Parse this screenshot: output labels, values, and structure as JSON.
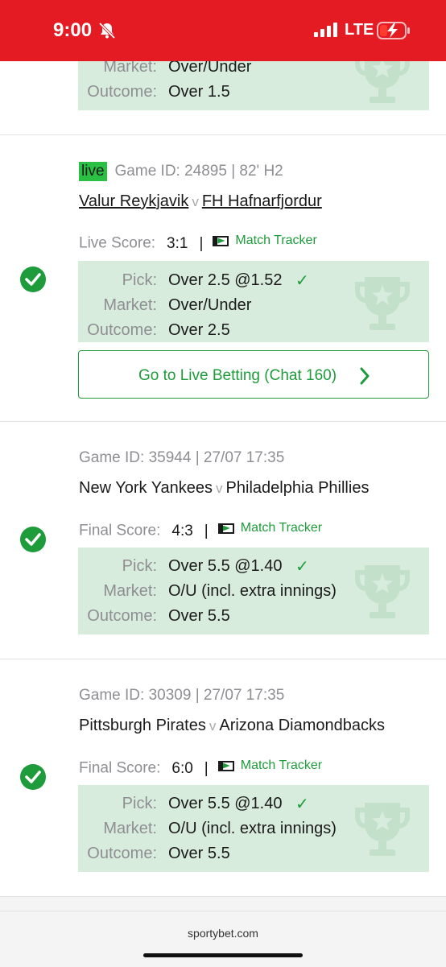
{
  "status_bar": {
    "time": "9:00",
    "network": "LTE"
  },
  "top_partial": {
    "market_label": "Market:",
    "market_value": "Over/Under",
    "outcome_label": "Outcome:",
    "outcome_value": "Over 1.5"
  },
  "bets": [
    {
      "live_label": "live",
      "game_id": "Game ID: 24895 | 82' H2",
      "home": "Valur Reykjavik",
      "vs": "v",
      "away": "FH Hafnarfjordur",
      "score_label": "Live Score:",
      "score": "3:1",
      "separator": "|",
      "tracker": "Match Tracker",
      "pick_label": "Pick:",
      "pick": "Over 2.5 @1.52",
      "market_label": "Market:",
      "market": "Over/Under",
      "outcome_label": "Outcome:",
      "outcome": "Over 2.5",
      "live_button": "Go to Live Betting (Chat 160)"
    },
    {
      "game_id": "Game ID: 35944 | 27/07 17:35",
      "home": "New York Yankees",
      "vs": "v",
      "away": "Philadelphia Phillies",
      "score_label": "Final Score:",
      "score": "4:3",
      "separator": "|",
      "tracker": "Match Tracker",
      "pick_label": "Pick:",
      "pick": "Over 5.5 @1.40",
      "market_label": "Market:",
      "market": "O/U (incl. extra innings)",
      "outcome_label": "Outcome:",
      "outcome": "Over 5.5"
    },
    {
      "game_id": "Game ID: 30309 | 27/07 17:35",
      "home": "Pittsburgh Pirates",
      "vs": "v",
      "away": "Arizona Diamondbacks",
      "score_label": "Final Score:",
      "score": "6:0",
      "separator": "|",
      "tracker": "Match Tracker",
      "pick_label": "Pick:",
      "pick": "Over 5.5 @1.40",
      "market_label": "Market:",
      "market": "O/U (incl. extra innings)",
      "outcome_label": "Outcome:",
      "outcome": "Over 5.5"
    }
  ],
  "footer": {
    "url": "sportybet.com"
  },
  "colors": {
    "brand_red": "#e41b23",
    "win_green": "#1e9b3a",
    "pick_bg": "#d8ecdd"
  }
}
